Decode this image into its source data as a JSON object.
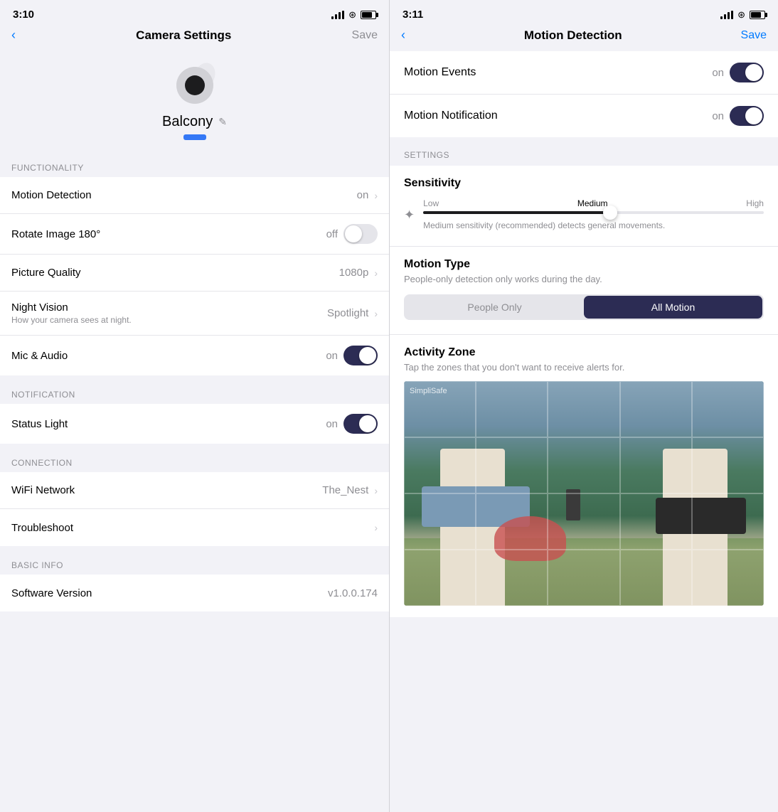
{
  "left_screen": {
    "status_time": "3:10",
    "nav_title": "Camera Settings",
    "nav_back": "<",
    "nav_action": "Save",
    "camera_name": "Balcony",
    "sections": {
      "functionality": {
        "label": "FUNCTIONALITY",
        "items": [
          {
            "label": "Motion Detection",
            "value": "on",
            "type": "chevron"
          },
          {
            "label": "Rotate Image 180°",
            "value": "off",
            "type": "toggle_off"
          },
          {
            "label": "Picture Quality",
            "value": "1080p",
            "type": "chevron"
          },
          {
            "label": "Night Vision",
            "sublabel": "How your camera sees at night.",
            "value": "Spotlight",
            "type": "chevron"
          },
          {
            "label": "Mic & Audio",
            "value": "on",
            "type": "toggle_on"
          }
        ]
      },
      "notification": {
        "label": "NOTIFICATION",
        "items": [
          {
            "label": "Status Light",
            "value": "on",
            "type": "toggle_on"
          }
        ]
      },
      "connection": {
        "label": "CONNECTION",
        "items": [
          {
            "label": "WiFi Network",
            "value": "The_Nest",
            "type": "chevron"
          },
          {
            "label": "Troubleshoot",
            "value": "",
            "type": "chevron"
          }
        ]
      },
      "basic_info": {
        "label": "BASIC INFO",
        "items": [
          {
            "label": "Software Version",
            "value": "v1.0.0.174",
            "type": "text"
          }
        ]
      }
    }
  },
  "right_screen": {
    "status_time": "3:11",
    "nav_title": "Motion Detection",
    "nav_back": "<",
    "nav_action": "Save",
    "motion_events": {
      "label": "Motion Events",
      "value": "on",
      "toggle_state": "on"
    },
    "motion_notification": {
      "label": "Motion Notification",
      "value": "on",
      "toggle_state": "on"
    },
    "settings_section_label": "SETTINGS",
    "sensitivity": {
      "title": "Sensitivity",
      "low_label": "Low",
      "medium_label": "Medium",
      "high_label": "High",
      "description": "Medium sensitivity (recommended) detects general movements."
    },
    "motion_type": {
      "title": "Motion Type",
      "description": "People-only detection only works during the day.",
      "option1": "People Only",
      "option2": "All Motion",
      "selected": "All Motion"
    },
    "activity_zone": {
      "title": "Activity Zone",
      "description": "Tap the zones that you don't want to receive alerts for.",
      "feed_watermark": "SimpliSafe"
    }
  }
}
